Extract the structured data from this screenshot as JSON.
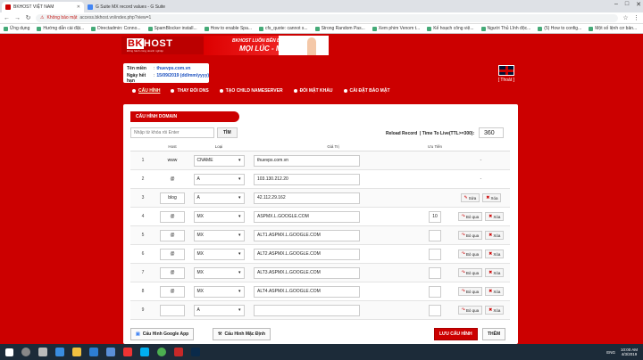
{
  "browser": {
    "tabs": [
      {
        "label": "BKHOST VIỆT NAM",
        "color": "#c00"
      },
      {
        "label": "G Suite MX record values - G Suite",
        "color": "#4285f4"
      }
    ],
    "url_warning": "Không bảo mật",
    "url": "access.bkhost.vn/index.php?view=1",
    "bookmarks": [
      "Ứng dụng",
      "Hướng dẫn cài đặt...",
      "Directadmin: Conno...",
      "SpamBlocker install...",
      "How to enable Spa...",
      "cfs_quote: cannot s...",
      "Strong Random Pas...",
      "Xem phim Venom t...",
      "Kế hoạch công việ...",
      "Người Thủ Lĩnh độc...",
      "(5) How to config...",
      "Một số lệnh cơ bản..."
    ]
  },
  "header": {
    "logo_bk": "BK",
    "logo_host": "HOST",
    "tagline": "Đồng hành cùng doanh nghiệp",
    "banner_line1": "BKHOST LUÔN BÊN BẠN",
    "banner_line2": "MỌI LÚC - MỌI NƠI"
  },
  "account": {
    "name_label": "Tên miền",
    "name_value": "thuevps.com.vn",
    "exp_label": "Ngày hết hạn",
    "exp_value": "15/09/2019 (dd/mm/yyyy)",
    "logout": "[ Thoát ]"
  },
  "menu": [
    "CẤU HÌNH",
    "THAY ĐỔI DNS",
    "TẠO CHILD NAMESERVER",
    "ĐỔI MẬT KHẨU",
    "CÀI ĐẶT BẢO MẬT"
  ],
  "section_title": "CẤU HÌNH DOMAIN",
  "search": {
    "placeholder": "Nhập từ khóa rồi Enter",
    "button": "TÌM"
  },
  "reload": "Reload Record",
  "ttl_label": "| Time To Live(TTL>=300):",
  "ttl_value": "360",
  "table": {
    "headers": [
      "",
      "Host",
      "Loại",
      "Giá Trị",
      "Ưu Tiên",
      ""
    ],
    "rows": [
      {
        "num": "1",
        "host": "www",
        "type": "CNAME",
        "value": "thuevps.com.vn",
        "priority": "",
        "edit": false,
        "actions": "dash"
      },
      {
        "num": "2",
        "host": "@",
        "type": "A",
        "value": "103.130.212.20",
        "priority": "",
        "edit": false,
        "actions": "dash"
      },
      {
        "num": "3",
        "host": "blog",
        "type": "A",
        "value": "42.112.29.162",
        "priority": "",
        "edit": true,
        "actions": "sua"
      },
      {
        "num": "4",
        "host": "@",
        "type": "MX",
        "value": "ASPMX.L.GOOGLE.COM",
        "priority": "10",
        "edit": true,
        "actions": "boqua"
      },
      {
        "num": "5",
        "host": "@",
        "type": "MX",
        "value": "ALT1.ASPMX.L.GOOGLE.COM",
        "priority": "",
        "edit": true,
        "actions": "boqua"
      },
      {
        "num": "6",
        "host": "@",
        "type": "MX",
        "value": "ALT2.ASPMX.L.GOOGLE.COM",
        "priority": "",
        "edit": true,
        "actions": "boqua"
      },
      {
        "num": "7",
        "host": "@",
        "type": "MX",
        "value": "ALT3.ASPMX.L.GOOGLE.COM",
        "priority": "",
        "edit": true,
        "actions": "boqua"
      },
      {
        "num": "8",
        "host": "@",
        "type": "MX",
        "value": "ALT4.ASPMX.L.GOOGLE.COM",
        "priority": "",
        "edit": true,
        "actions": "boqua"
      },
      {
        "num": "9",
        "host": "",
        "type": "A",
        "value": "",
        "priority": "",
        "edit": true,
        "actions": "boqua"
      }
    ],
    "dash": "-",
    "edit_label": "Sửa",
    "skip_label": "Bỏ qua",
    "delete_label": "Xóa"
  },
  "buttons": {
    "google_app": "Cấu Hình Google App",
    "default_cfg": "Cấu Hình Mặc Định",
    "save": "LƯU CẤU HÌNH",
    "add": "THÊM"
  },
  "taskbar": {
    "time": "10:00 AM",
    "date": "4/3/2019",
    "lang": "ENG"
  }
}
